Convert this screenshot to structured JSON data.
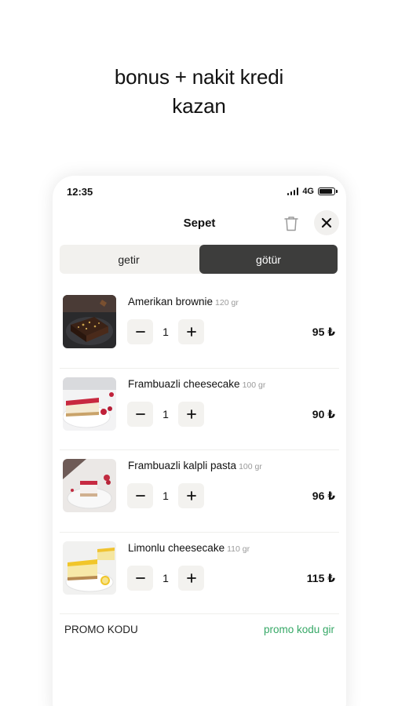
{
  "headline": {
    "line1": "bonus + nakit kredi",
    "line2": "kazan"
  },
  "status": {
    "time": "12:35",
    "network": "4G"
  },
  "header": {
    "title": "Sepet"
  },
  "tabs": [
    {
      "label": "getir",
      "active": false
    },
    {
      "label": "götür",
      "active": true
    }
  ],
  "items": [
    {
      "name": "Amerikan brownie",
      "weight": "120 gr",
      "qty": "1",
      "price": "95 ₺",
      "image": "brownie"
    },
    {
      "name": "Frambuazli cheesecake",
      "weight": "100 gr",
      "qty": "1",
      "price": "90 ₺",
      "image": "raspberry-cheesecake"
    },
    {
      "name": "Frambuazli kalpli pasta",
      "weight": "100 gr",
      "qty": "1",
      "price": "96 ₺",
      "image": "raspberry-heart-cake"
    },
    {
      "name": "Limonlu cheesecake",
      "weight": "110 gr",
      "qty": "1",
      "price": "115 ₺",
      "image": "lemon-cheesecake"
    }
  ],
  "promo": {
    "label": "PROMO KODU",
    "link": "promo kodu gir"
  },
  "colors": {
    "accent_green": "#36a866",
    "active_tab": "#3d3d3c",
    "muted_bg": "#f2f1ee"
  }
}
